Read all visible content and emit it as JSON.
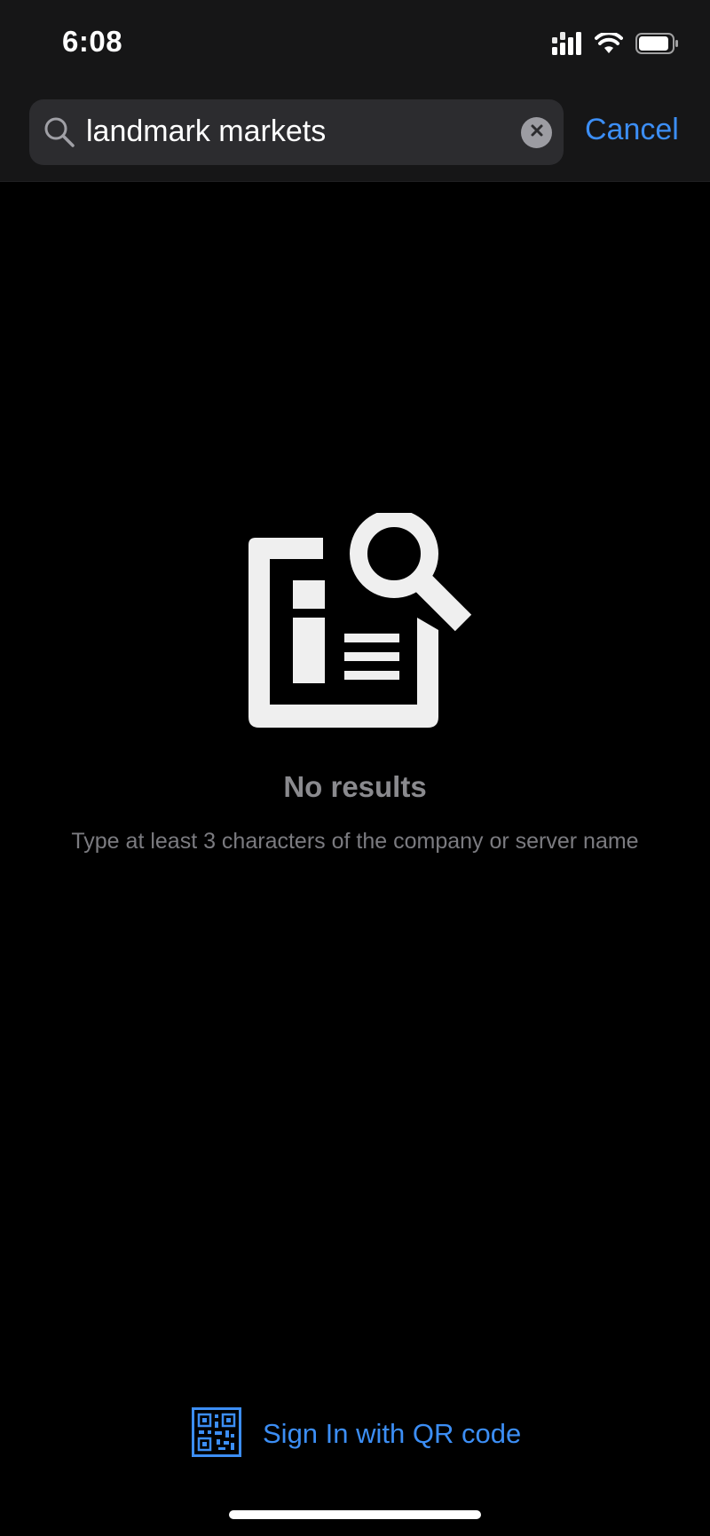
{
  "status_bar": {
    "time": "6:08",
    "icons": [
      "cellular-signal-icon",
      "wifi-icon",
      "battery-icon"
    ]
  },
  "search": {
    "value": "landmark markets",
    "icon": "search-icon",
    "clear_icon": "clear-icon",
    "cancel_label": "Cancel"
  },
  "empty_state": {
    "icon": "document-search-icon",
    "title": "No results",
    "subtitle": "Type at least 3 characters of the company or server name"
  },
  "footer": {
    "qr_icon": "qr-code-icon",
    "qr_label": "Sign In with QR code"
  },
  "colors": {
    "accent": "#3c8ef5",
    "background": "#000000",
    "header_background": "#161617",
    "search_field": "#2c2c2f",
    "muted_text": "#8a8a8e"
  }
}
